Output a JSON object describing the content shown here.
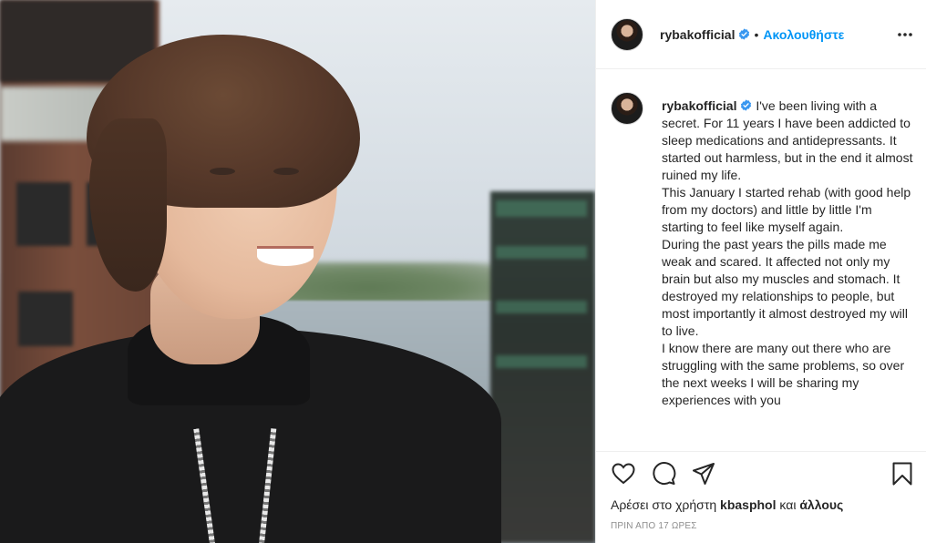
{
  "post": {
    "username": "rybakofficial",
    "follow_label": "Ακολουθήστε",
    "separator": "•",
    "caption": " I've been living with a secret. For 11 years I have been addicted to sleep medications and antidepressants. It started out harmless, but in the end it almost ruined my life.\nThis January I started rehab (with good help from my doctors) and little by little I'm starting to feel like myself again.\nDuring the past years the pills made me weak and scared. It affected not only my brain but also my muscles and stomach. It destroyed my relationships to people, but most importantly it almost destroyed my will to live.\nI know there are many out there who are struggling with the same problems, so over the next weeks I will be sharing my experiences with you",
    "likes_prefix": "Αρέσει στο χρήστη ",
    "likes_user": "kbasphol",
    "likes_middle": " και ",
    "likes_suffix": "άλλους",
    "timestamp": "ΠΡΙΝ ΑΠΟ 17 ΩΡΕΣ"
  },
  "icons": {
    "verified": "verified-badge-icon",
    "more": "more-options-icon",
    "like": "heart-icon",
    "comment": "comment-bubble-icon",
    "share": "paper-plane-icon",
    "save": "bookmark-icon"
  },
  "colors": {
    "accent": "#0095f6",
    "text": "#262626",
    "muted": "#8e8e8e",
    "border": "#efefef"
  }
}
